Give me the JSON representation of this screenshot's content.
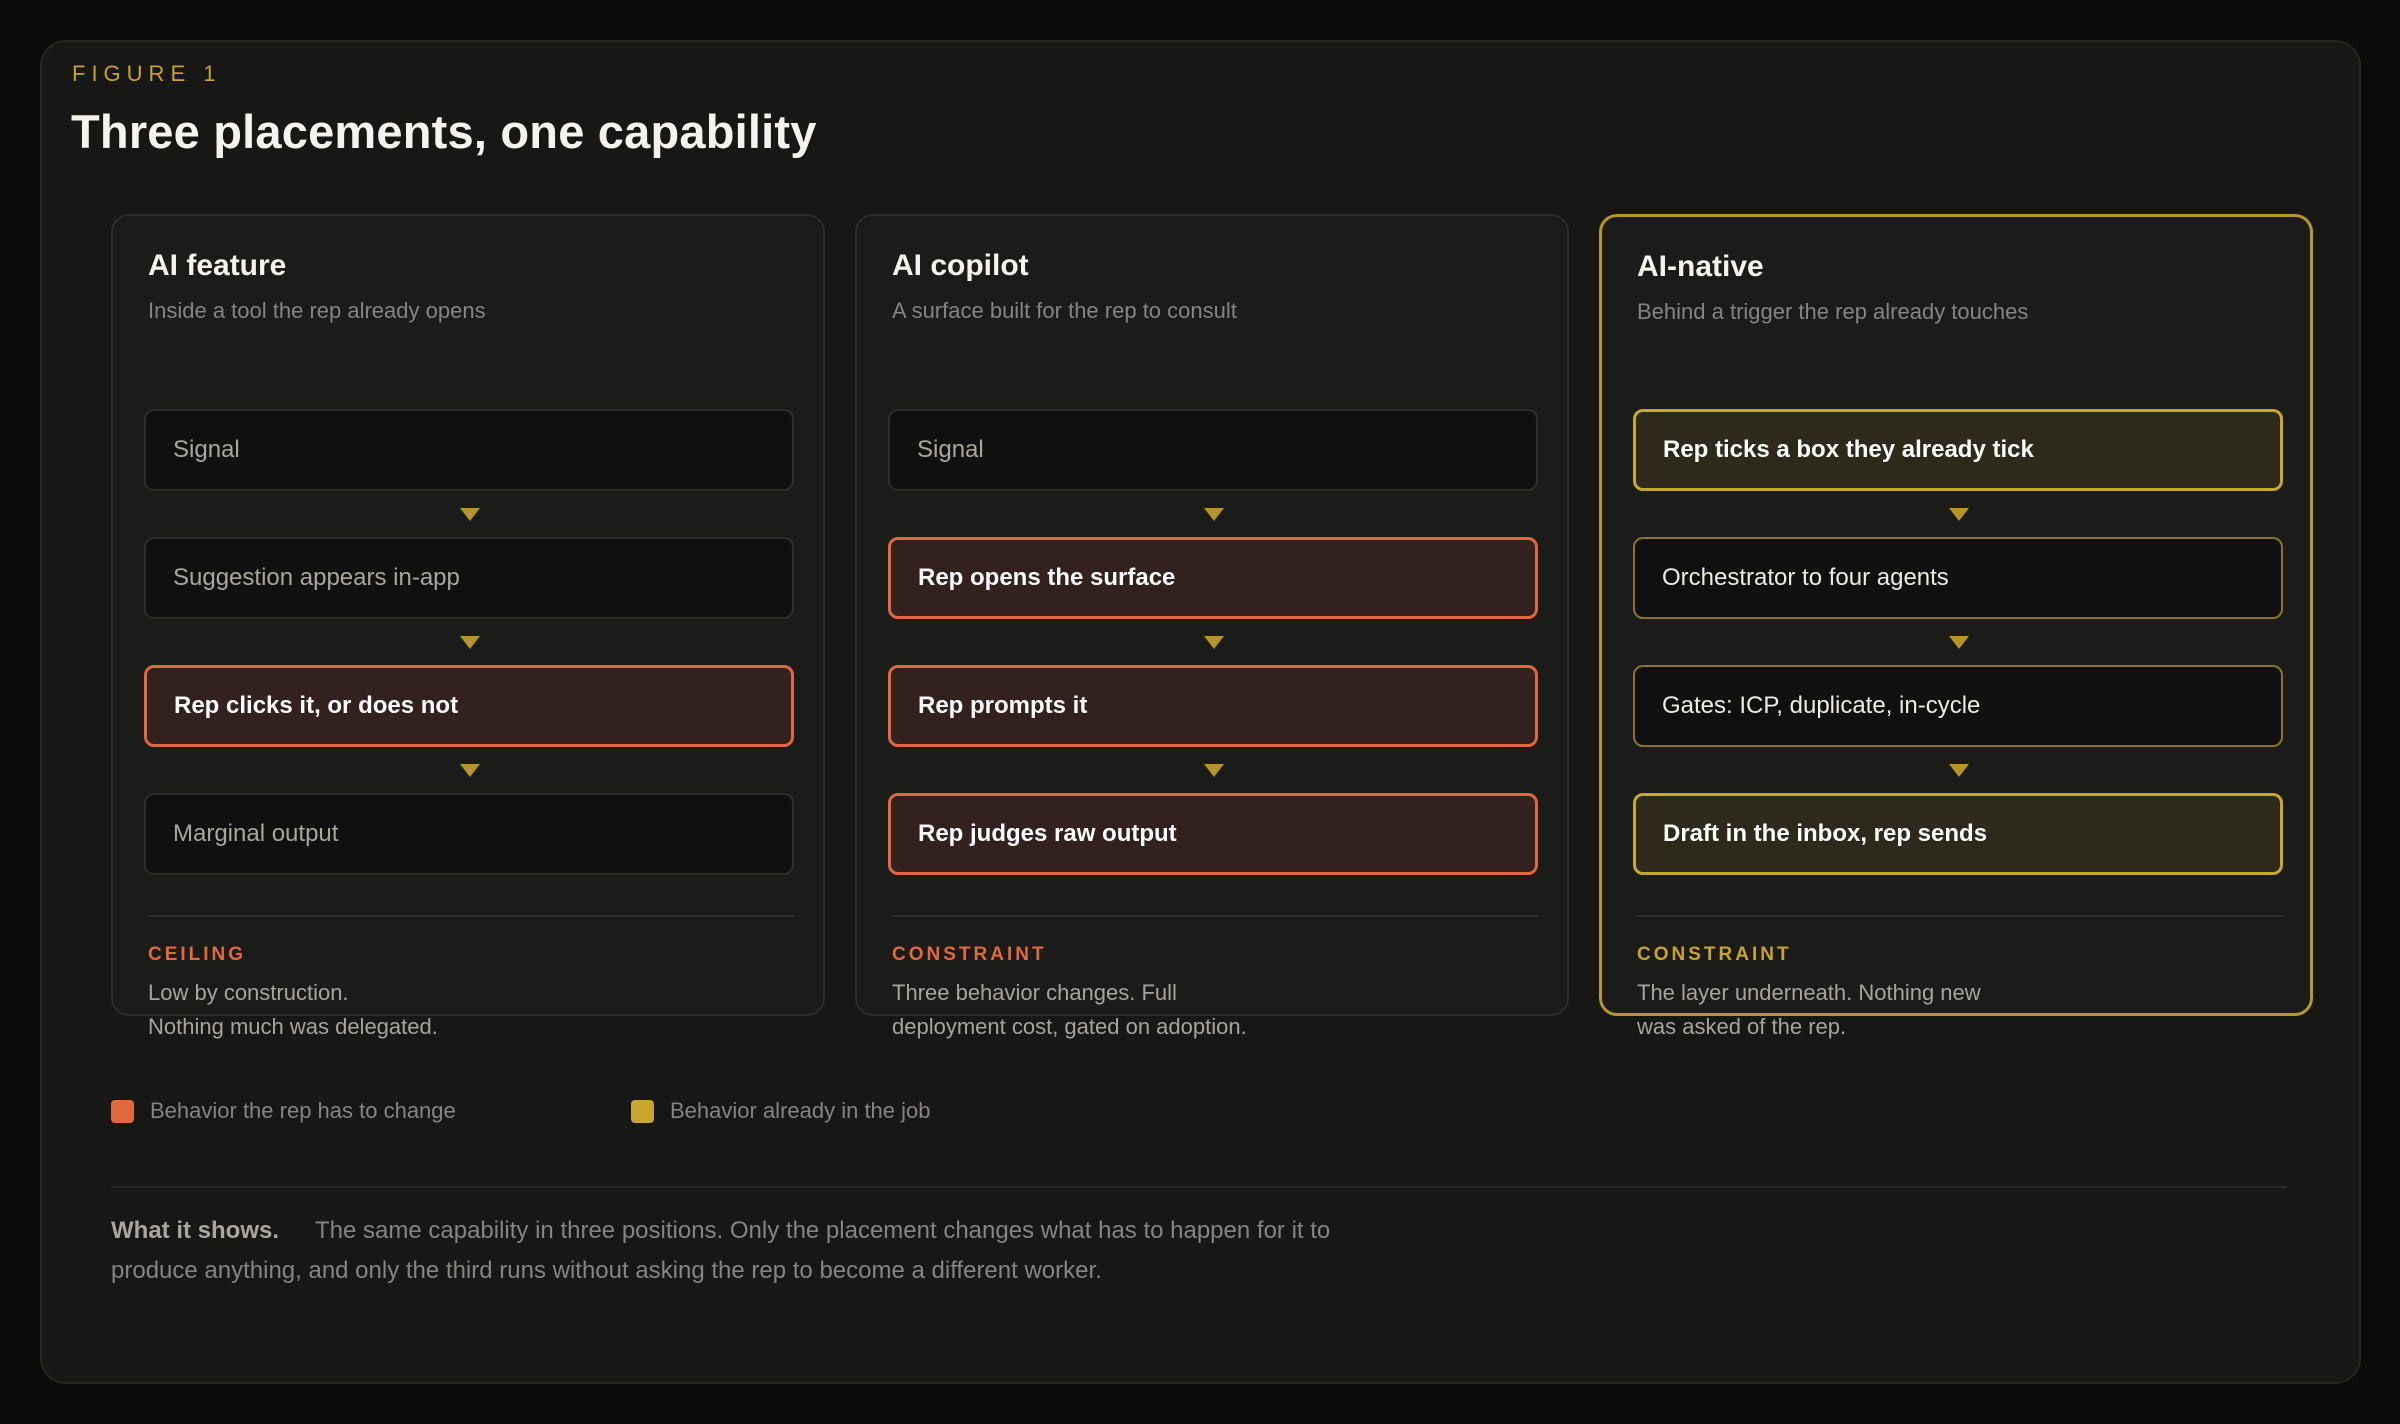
{
  "figure": {
    "eyebrow": "FIGURE 1",
    "title": "Three placements, one capability"
  },
  "colors": {
    "change": "#e06a3d",
    "job": "#c9a62f",
    "background": "#171716"
  },
  "cards": [
    {
      "title": "AI feature",
      "subtitle": "Inside a tool the rep already opens",
      "steps": [
        {
          "label": "Signal",
          "kind": "neutral"
        },
        {
          "label": "Suggestion appears in-app",
          "kind": "neutral"
        },
        {
          "label": "Rep clicks it, or does not",
          "kind": "change"
        },
        {
          "label": "Marginal output",
          "kind": "neutral"
        }
      ],
      "footer_label": "CEILING",
      "footer_line1": "Low by construction.",
      "footer_line2": "Nothing much was delegated."
    },
    {
      "title": "AI copilot",
      "subtitle": "A surface built for the rep to consult",
      "steps": [
        {
          "label": "Signal",
          "kind": "neutral"
        },
        {
          "label": "Rep opens the surface",
          "kind": "change"
        },
        {
          "label": "Rep prompts it",
          "kind": "change"
        },
        {
          "label": "Rep judges raw output",
          "kind": "change"
        }
      ],
      "footer_label": "CONSTRAINT",
      "footer_line1": "Three behavior changes. Full",
      "footer_line2": "deployment cost, gated on adoption."
    },
    {
      "title": "AI-native",
      "subtitle": "Behind a trigger the rep already touches",
      "steps": [
        {
          "label": "Rep ticks a box they already tick",
          "kind": "job"
        },
        {
          "label": "Orchestrator to four agents",
          "kind": "neutral"
        },
        {
          "label": "Gates: ICP, duplicate, in-cycle",
          "kind": "neutral"
        },
        {
          "label": "Draft in the inbox, rep sends",
          "kind": "job"
        }
      ],
      "footer_label": "CONSTRAINT",
      "footer_line1": "The layer underneath. Nothing new",
      "footer_line2": "was asked of the rep."
    }
  ],
  "legend": {
    "change": "Behavior the rep has to change",
    "job": "Behavior already in the job"
  },
  "what_it_shows": {
    "label": "What it shows.",
    "text": "The same capability in three positions. Only the placement changes what has to happen for it to produce anything, and only the third runs without asking the rep to become a different worker."
  }
}
